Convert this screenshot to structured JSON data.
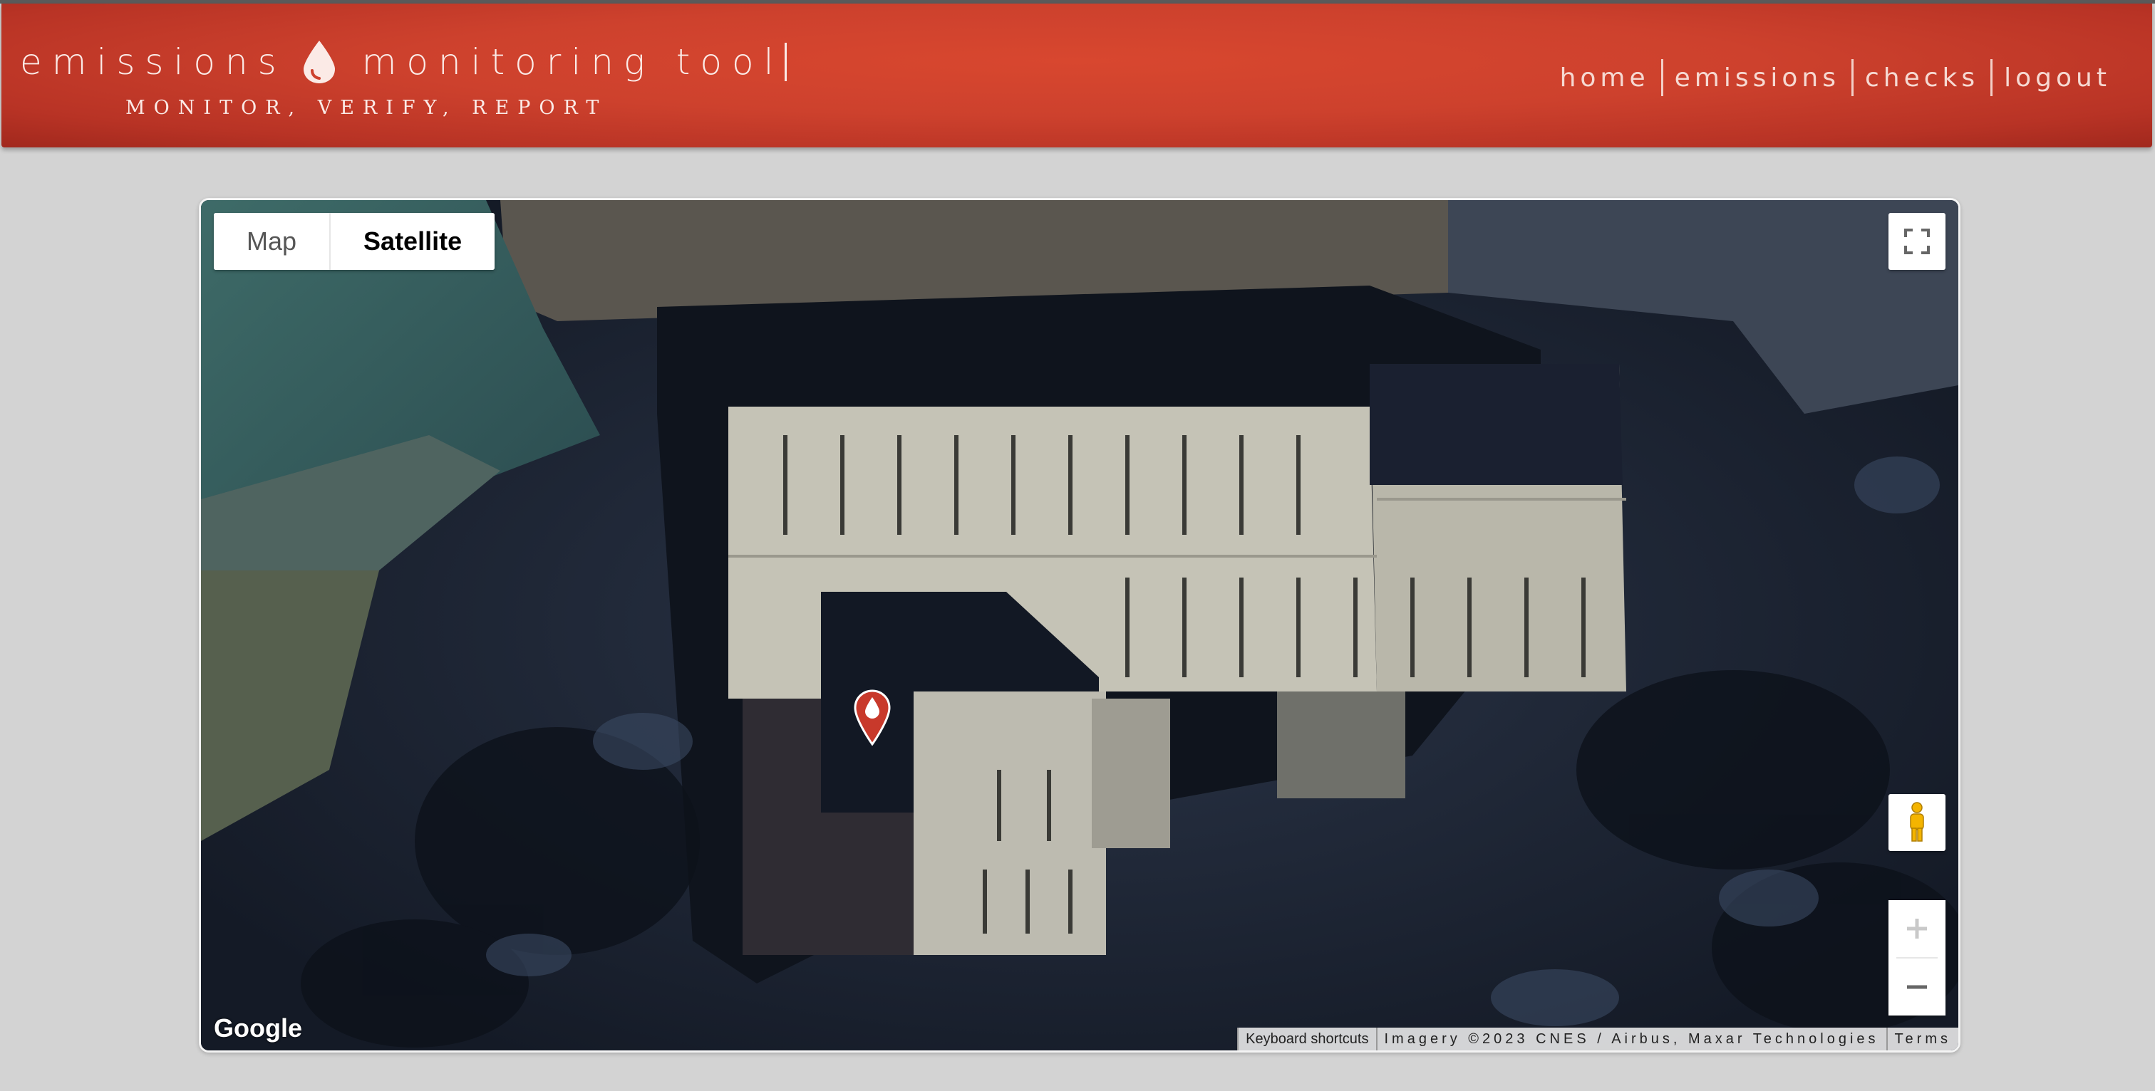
{
  "app": {
    "title": "emissions",
    "title_rest": "monitoring tool",
    "tagline": "MONITOR, VERIFY, REPORT",
    "brand_color": "#cd412d"
  },
  "nav": {
    "items": [
      {
        "label": "home"
      },
      {
        "label": "emissions"
      },
      {
        "label": "checks"
      },
      {
        "label": "logout"
      }
    ]
  },
  "map": {
    "map_type_options": [
      {
        "label": "Map",
        "selected": false
      },
      {
        "label": "Satellite",
        "selected": true
      }
    ],
    "google_logo": "Google",
    "keyboard_shortcuts": "Keyboard shortcuts",
    "imagery_credit": "Imagery ©2023 CNES / Airbus, Maxar Technologies",
    "terms": "Terms",
    "icons": {
      "fullscreen": "fullscreen-icon",
      "pegman": "pegman-icon",
      "zoom_in": "plus-icon",
      "zoom_out": "minus-icon",
      "marker": "drop-marker-icon"
    }
  }
}
